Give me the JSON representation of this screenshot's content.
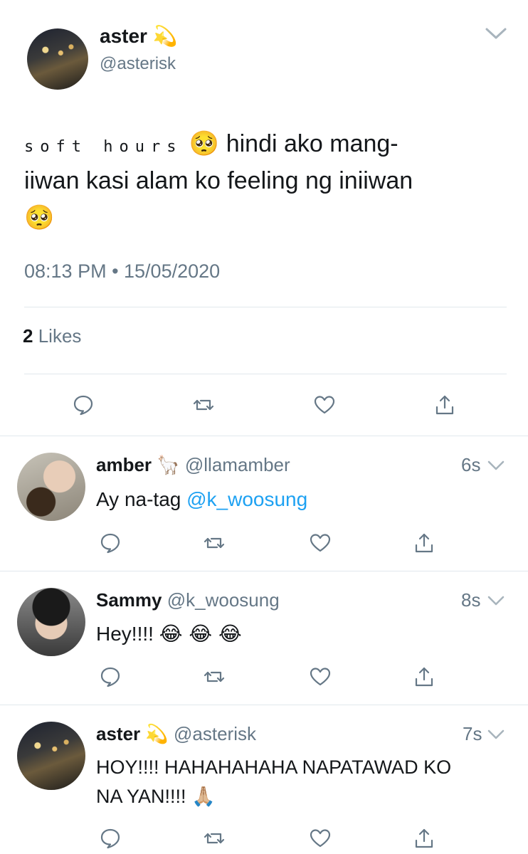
{
  "main_tweet": {
    "name": "aster",
    "name_emoji": "💫",
    "handle": "@asterisk",
    "text_spaced": "soft hours",
    "text_line1_emoji": "🥺",
    "text_line1": "hindi ako mang-",
    "text_line2": "iiwan kasi alam ko feeling ng iniiwan",
    "text_line3_emoji": "🥺",
    "timestamp": "08:13 PM • 15/05/2020",
    "likes_count": "2",
    "likes_label": "Likes"
  },
  "replies": [
    {
      "name": "amber",
      "name_emoji": "🦙",
      "handle": "@llamamber",
      "time": "6s",
      "text": "Ay na-tag ",
      "mention": "@k_woosung"
    },
    {
      "name": "Sammy",
      "handle": "@k_woosung",
      "time": "8s",
      "text": "Hey!!!! ",
      "emojis": "😂 😂 😂"
    },
    {
      "name": "aster",
      "name_emoji": "💫",
      "handle": "@asterisk",
      "time": "7s",
      "text_line1": "HOY!!!! HAHAHAHAHA NAPATAWAD KO",
      "text_line2": "NA YAN!!!! ",
      "emoji": "🙏🏼"
    }
  ],
  "icons": {
    "reply": "speech-bubble-icon",
    "retweet": "retweet-icon",
    "like": "heart-icon",
    "share": "share-icon",
    "menu": "chevron-down-icon"
  }
}
